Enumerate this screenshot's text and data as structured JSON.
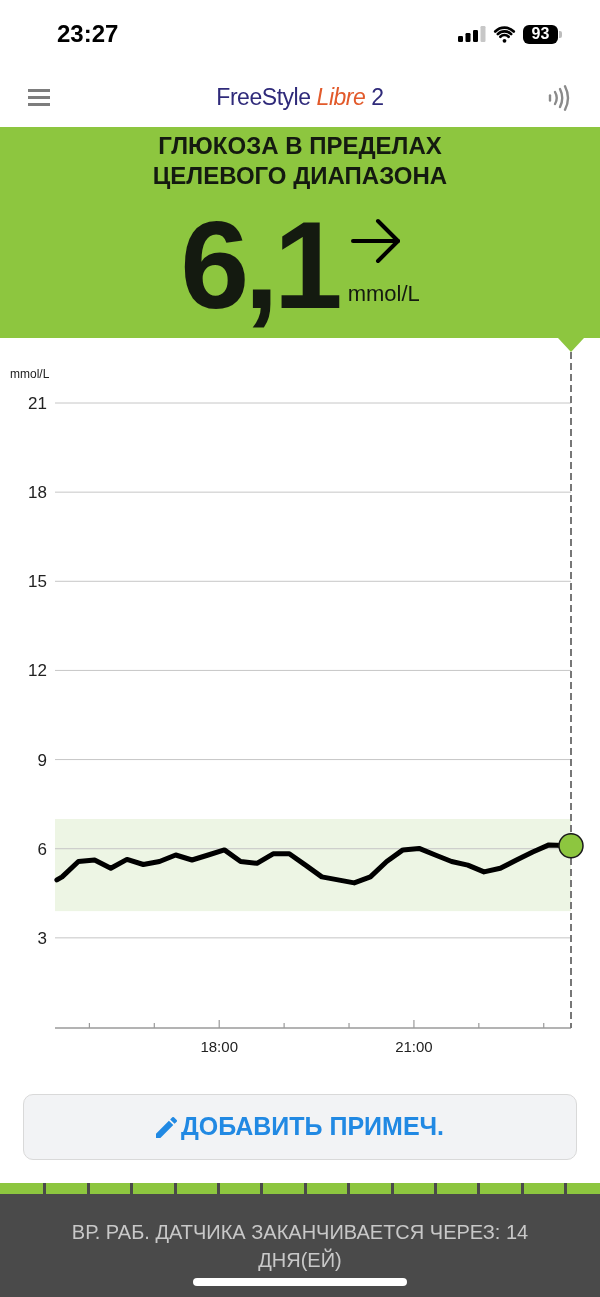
{
  "status_bar": {
    "time": "23:27",
    "battery": "93"
  },
  "app_header": {
    "logo": [
      {
        "kind": "brand",
        "text": "FreeStyle"
      },
      {
        "kind": "product",
        "text": "Libre"
      },
      {
        "kind": "version",
        "text": "2"
      }
    ]
  },
  "glucose_banner": {
    "kind": "in_target",
    "title": "ГЛЮКОЗА В ПРЕДЕЛАХ ЦЕЛЕВОГО ДИАПАЗОНА",
    "value": "6,1",
    "trend_arrow": {
      "kind": "steady"
    },
    "unit": "mmol/L"
  },
  "chart": {
    "chart_data": {
      "type": "line",
      "ylabel": "mmol/L",
      "x": [
        15.5,
        15.58,
        15.83,
        16.08,
        16.33,
        16.58,
        16.83,
        17.08,
        17.33,
        17.58,
        17.83,
        18.08,
        18.33,
        18.58,
        18.83,
        19.08,
        19.33,
        19.58,
        19.83,
        20.08,
        20.33,
        20.58,
        20.83,
        21.08,
        21.33,
        21.58,
        21.83,
        22.08,
        22.33,
        22.58,
        22.83,
        23.08,
        23.42
      ],
      "values": [
        4.95,
        5.05,
        5.57,
        5.62,
        5.34,
        5.64,
        5.47,
        5.57,
        5.79,
        5.62,
        5.79,
        5.96,
        5.57,
        5.51,
        5.83,
        5.83,
        5.45,
        5.05,
        4.95,
        4.85,
        5.05,
        5.57,
        5.96,
        6.01,
        5.79,
        5.57,
        5.45,
        5.22,
        5.34,
        5.62,
        5.89,
        6.13,
        6.1
      ],
      "xlim": [
        15.47,
        23.42
      ],
      "ylim": [
        0,
        21
      ],
      "xticks": [
        {
          "value": 18,
          "label": "18:00"
        },
        {
          "value": 21,
          "label": "21:00"
        }
      ],
      "yticks": [
        3,
        6,
        9,
        12,
        15,
        18,
        21
      ],
      "grid": true,
      "bands": [
        {
          "axis": "y",
          "from": 3.9,
          "to": 7.0
        }
      ]
    }
  },
  "add_note_button": {
    "label": "ДОБАВИТЬ ПРИМЕЧ."
  },
  "sensor_status": {
    "level": 1,
    "text": "ВР. РАБ. ДАТЧИКА ЗАКАНЧИВАЕТСЯ ЧЕРЕЗ: 14 ДНЯ(ЕЙ)"
  }
}
